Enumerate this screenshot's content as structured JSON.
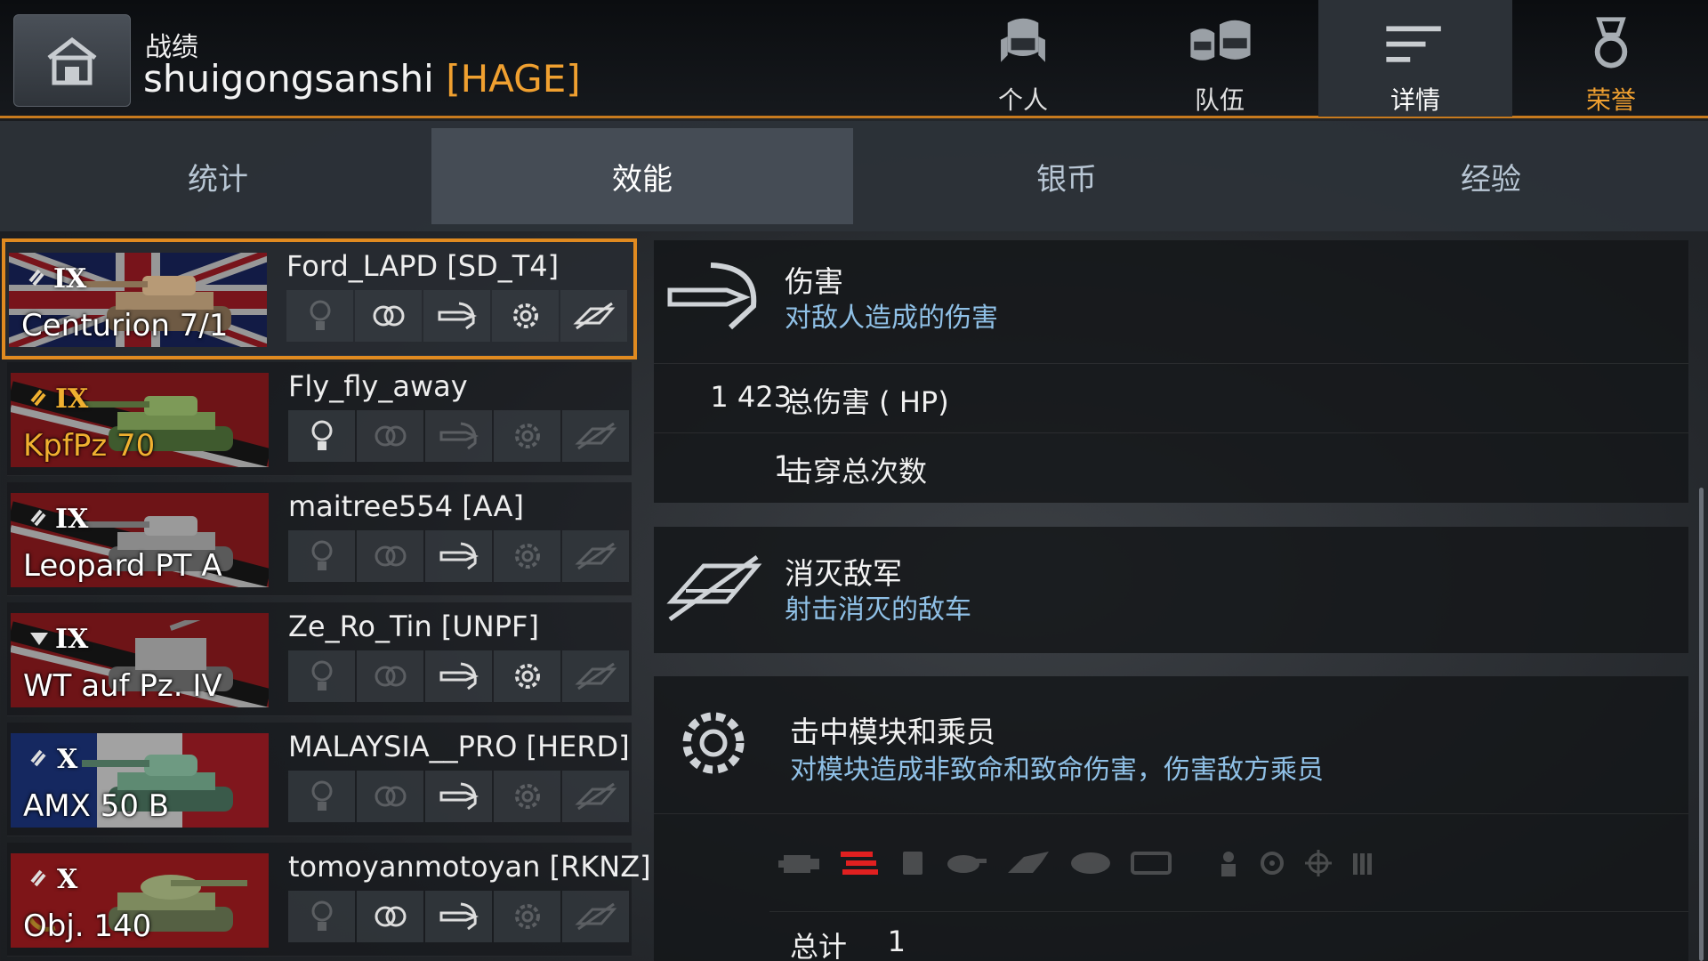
{
  "header": {
    "title": "战绩",
    "player_name": "shuigongsanshi",
    "clan_tag": "[HAGE]",
    "nav": [
      {
        "label": "个人",
        "icon": "soldier-icon"
      },
      {
        "label": "队伍",
        "icon": "team-icon"
      },
      {
        "label": "详情",
        "icon": "details-icon"
      },
      {
        "label": "荣誉",
        "icon": "medal-icon"
      }
    ]
  },
  "tabs": [
    "统计",
    "效能",
    "银币",
    "经验"
  ],
  "active_tab": "效能",
  "vehicles": [
    {
      "tier": "IX",
      "tank": "Centurion 7/1",
      "player": "Ford_LAPD [SD_T4]",
      "flag": "uk",
      "premium": false,
      "medals": [
        false,
        true,
        true,
        true,
        true
      ]
    },
    {
      "tier": "IX",
      "tank": "KpfPz 70",
      "player": "Fly_fly_away",
      "flag": "germany",
      "premium": true,
      "medals": [
        true,
        false,
        false,
        false,
        false
      ]
    },
    {
      "tier": "IX",
      "tank": "Leopard PT A",
      "player": "maitree554 [AA]",
      "flag": "germany",
      "premium": false,
      "medals": [
        false,
        false,
        true,
        false,
        false
      ]
    },
    {
      "tier": "IX",
      "tank": "WT auf Pz. IV",
      "player": "Ze_Ro_Tin [UNPF]",
      "flag": "germany",
      "premium": false,
      "medals": [
        false,
        false,
        true,
        true,
        false
      ]
    },
    {
      "tier": "X",
      "tank": "AMX 50 B",
      "player": "MALAYSIA__PRO [HERD]",
      "flag": "france",
      "premium": false,
      "medals": [
        false,
        false,
        true,
        false,
        false
      ]
    },
    {
      "tier": "X",
      "tank": "Obj. 140",
      "player": "tomoyanmotoyan [RKNZ]",
      "flag": "ussr",
      "premium": false,
      "medals": [
        false,
        true,
        true,
        false,
        false
      ]
    }
  ],
  "damage": {
    "title": "伤害",
    "subtitle": "对敌人造成的伤害",
    "total_damage_value": "1 423",
    "total_damage_label": "总伤害 ( HP)",
    "penetrations_value": "1",
    "penetrations_label": "击穿总次数"
  },
  "kills": {
    "title": "消灭敌军",
    "subtitle": "射击消灭的敌车"
  },
  "modules": {
    "title": "击中模块和乘员",
    "subtitle": "对模块造成非致命和致命伤害，伤害敌方乘员",
    "total_value": "1",
    "total_label": "总计"
  },
  "colors": {
    "accent": "#e08a20",
    "subtitle": "#8fc0e6",
    "hit": "#e02020"
  }
}
